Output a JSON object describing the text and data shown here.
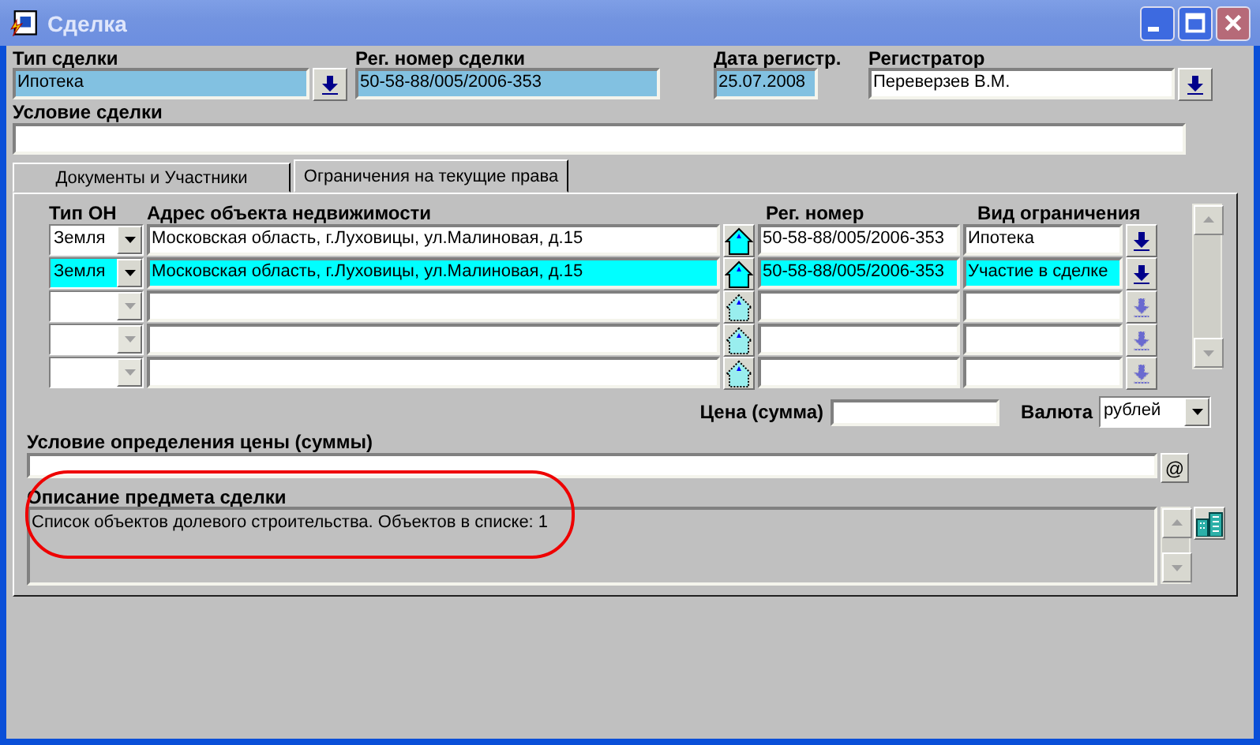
{
  "window": {
    "title": "Сделка"
  },
  "header": {
    "deal_type": {
      "label": "Тип сделки",
      "value": "Ипотека"
    },
    "reg_number": {
      "label": "Рег. номер сделки",
      "value": "50-58-88/005/2006-353"
    },
    "reg_date": {
      "label": "Дата регистр.",
      "value": "25.07.2008"
    },
    "registrar": {
      "label": "Регистратор",
      "value": "Переверзев В.М."
    },
    "condition": {
      "label": "Условие сделки"
    }
  },
  "tabs": [
    {
      "label": "Документы и Участники",
      "selected": false
    },
    {
      "label": "Ограничения на текущие права",
      "selected": true
    }
  ],
  "table": {
    "columns": [
      "Тип ОН",
      "Адрес объекта недвижимости",
      "Рег. номер",
      "Вид ограничения"
    ],
    "rows": [
      {
        "type": "Земля",
        "address": "Московская область, г.Луховицы, ул.Малиновая, д.15",
        "reg_number": "50-58-88/005/2006-353",
        "restriction": "Ипотека",
        "selected": false,
        "disabled": false
      },
      {
        "type": "Земля",
        "address": "Московская область, г.Луховицы, ул.Малиновая, д.15",
        "reg_number": "50-58-88/005/2006-353",
        "restriction": "Участие в сделке",
        "selected": true,
        "disabled": false
      },
      {
        "selected": false,
        "disabled": true
      },
      {
        "selected": false,
        "disabled": true
      },
      {
        "selected": false,
        "disabled": true
      }
    ]
  },
  "price": {
    "label": "Цена (сумма)",
    "currency_label": "Валюта",
    "currency": "рублей"
  },
  "price_condition": {
    "label": "Условие определения цены (суммы)",
    "button": "@"
  },
  "description": {
    "label": "Описание предмета сделки",
    "value": "Список объектов долевого строительства. Объектов в списке: 1"
  }
}
